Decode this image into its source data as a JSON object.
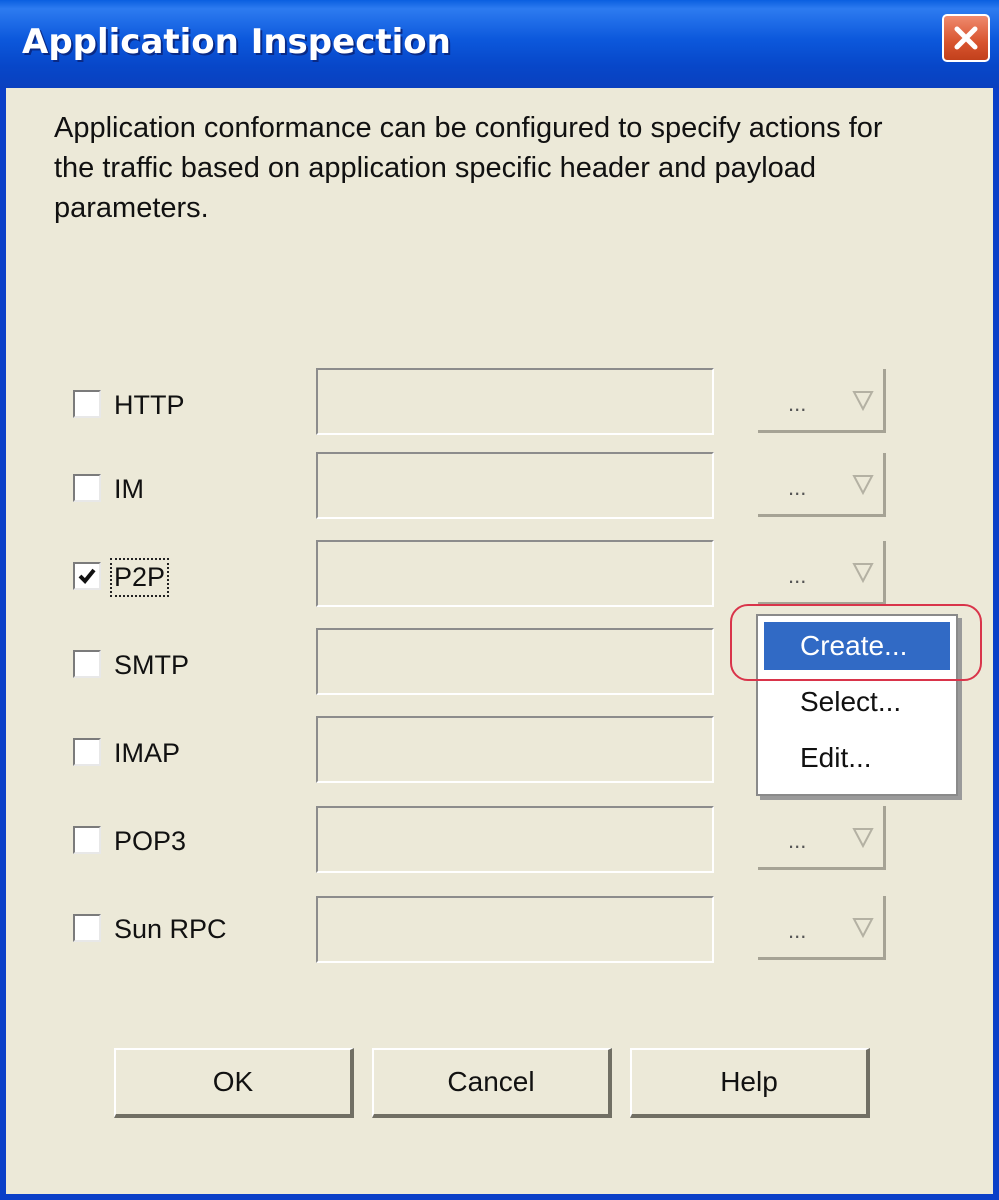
{
  "window": {
    "title": "Application Inspection"
  },
  "description": "Application conformance can be configured to specify actions for the traffic based on application specific header and payload parameters.",
  "protocols": [
    {
      "label": "HTTP",
      "checked": false,
      "field_value": "",
      "dropdown_label": "..."
    },
    {
      "label": "IM",
      "checked": false,
      "field_value": "",
      "dropdown_label": "..."
    },
    {
      "label": "P2P",
      "checked": true,
      "field_value": "",
      "dropdown_label": "..."
    },
    {
      "label": "SMTP",
      "checked": false,
      "field_value": "",
      "dropdown_label": "..."
    },
    {
      "label": "IMAP",
      "checked": false,
      "field_value": "",
      "dropdown_label": "..."
    },
    {
      "label": "POP3",
      "checked": false,
      "field_value": "",
      "dropdown_label": "..."
    },
    {
      "label": "Sun RPC",
      "checked": false,
      "field_value": "",
      "dropdown_label": "..."
    }
  ],
  "context_menu": {
    "items": [
      {
        "label": "Create...",
        "selected": true
      },
      {
        "label": "Select...",
        "selected": false
      },
      {
        "label": "Edit...",
        "selected": false
      }
    ]
  },
  "buttons": {
    "ok": "OK",
    "cancel": "Cancel",
    "help": "Help"
  },
  "colors": {
    "titlebar": "#0a50d4",
    "dialog_bg": "#ece9d8",
    "menu_selected": "#316ac5",
    "annotation_circle": "#d9344a"
  }
}
